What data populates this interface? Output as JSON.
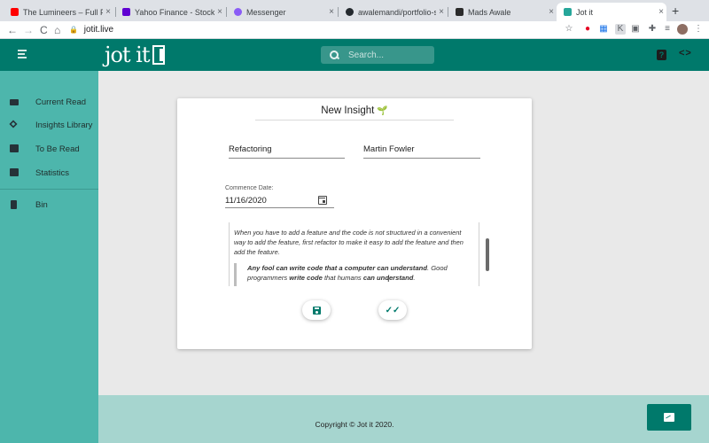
{
  "browser": {
    "tabs": [
      {
        "title": "The Lumineers – Full Perform",
        "favicon_color": "#ff0000",
        "active": false
      },
      {
        "title": "Yahoo Finance - Stock Mark",
        "favicon_color": "#6001d2",
        "active": false
      },
      {
        "title": "Messenger",
        "favicon_color": "#8a5cf6",
        "active": false
      },
      {
        "title": "awalemandi/portfolio-site",
        "favicon_color": "#24292e",
        "active": false
      },
      {
        "title": "Mads Awale",
        "favicon_color": "#2b2b2b",
        "active": false
      },
      {
        "title": "Jot it",
        "favicon_color": "#26a69a",
        "active": true
      }
    ],
    "new_tab_label": "+",
    "close_label": "×",
    "url": "jotit.live",
    "nav": {
      "back": "←",
      "forward": "→",
      "reload": "C",
      "home": "⌂"
    }
  },
  "header": {
    "logo_text": "jot it",
    "search_placeholder": "Search...",
    "menu_icon": "menu-collapse-icon",
    "help_icon": "help-icon",
    "code_icon_label": "<>",
    "help_label": "?"
  },
  "sidebar": {
    "items": [
      {
        "label": "Current Read",
        "icon": "new-icon"
      },
      {
        "label": "Insights Library",
        "icon": "layers-icon"
      },
      {
        "label": "To Be Read",
        "icon": "queue-icon"
      },
      {
        "label": "Statistics",
        "icon": "bar-chart-icon"
      }
    ],
    "bin": {
      "label": "Bin",
      "icon": "trash-icon"
    }
  },
  "insight_form": {
    "title": "New Insight",
    "title_emoji": "🌱",
    "book_title": "Refactoring",
    "author": "Martin Fowler",
    "commence_label": "Commence Date:",
    "commence_date": "11/16/2020",
    "body_paragraph": "When you have to add a feature and the code is not structured in a convenient way to add the feature, first refactor to make it easy to add the feature and then add the feature.",
    "quote_part1": "Any fool can write code that a computer can understand",
    "quote_part2": ". Good programmers ",
    "quote_part3": "write code",
    "quote_part4": " that humans ",
    "quote_part5": "can understand",
    "quote_part6": "."
  },
  "footer": {
    "copyright": "Copyright © Jot it 2020."
  },
  "colors": {
    "primary": "#00796b",
    "sidebar": "#4db6ac",
    "footer": "#a6d5cf",
    "background": "#e9e9e9"
  }
}
